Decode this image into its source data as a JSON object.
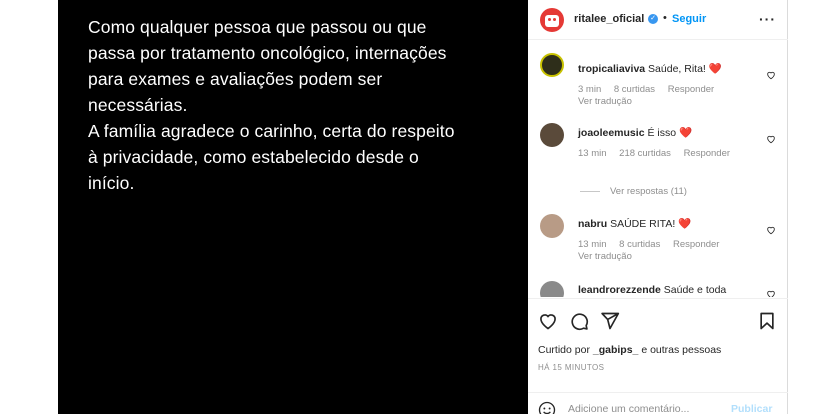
{
  "post": {
    "image_text": "Como qualquer pessoa que passou ou que\npassa por tratamento oncológico, internações\npara exames e avaliações podem ser\nnecessárias.\nA família agradece o carinho, certa do respeito\nà privacidade, como estabelecido desde o\ninício."
  },
  "header": {
    "username": "ritalee_oficial",
    "separator": "•",
    "follow_label": "Seguir",
    "more_label": "···"
  },
  "comments": [
    {
      "user": "tropicaliaviva",
      "text": "Saúde, Rita!",
      "time": "3 min",
      "likes": "8 curtidas",
      "reply": "Responder",
      "translate": "Ver tradução"
    },
    {
      "user": "joaoleemusic",
      "text": "É isso",
      "time": "13 min",
      "likes": "218 curtidas",
      "reply": "Responder"
    },
    {
      "user": "nabru",
      "text": "SAÚDE RITA!",
      "time": "13 min",
      "likes": "8 curtidas",
      "reply": "Responder",
      "translate": "Ver tradução"
    },
    {
      "user": "leandrorezzende",
      "text": "Saúde e toda"
    }
  ],
  "view_replies": "Ver respostas (11)",
  "liked_by": {
    "prefix": "Curtido por",
    "user": "_gabips_",
    "suffix": "e outras pessoas"
  },
  "timestamp": "HÁ 15 MINUTOS",
  "add_comment": {
    "placeholder": "Adicione um comentário...",
    "publish_label": "Publicar"
  },
  "colors": {
    "accent": "#0095f6",
    "heart": "#ed4956",
    "verified": "#3897f0",
    "brand_avatar": "#e53935"
  }
}
